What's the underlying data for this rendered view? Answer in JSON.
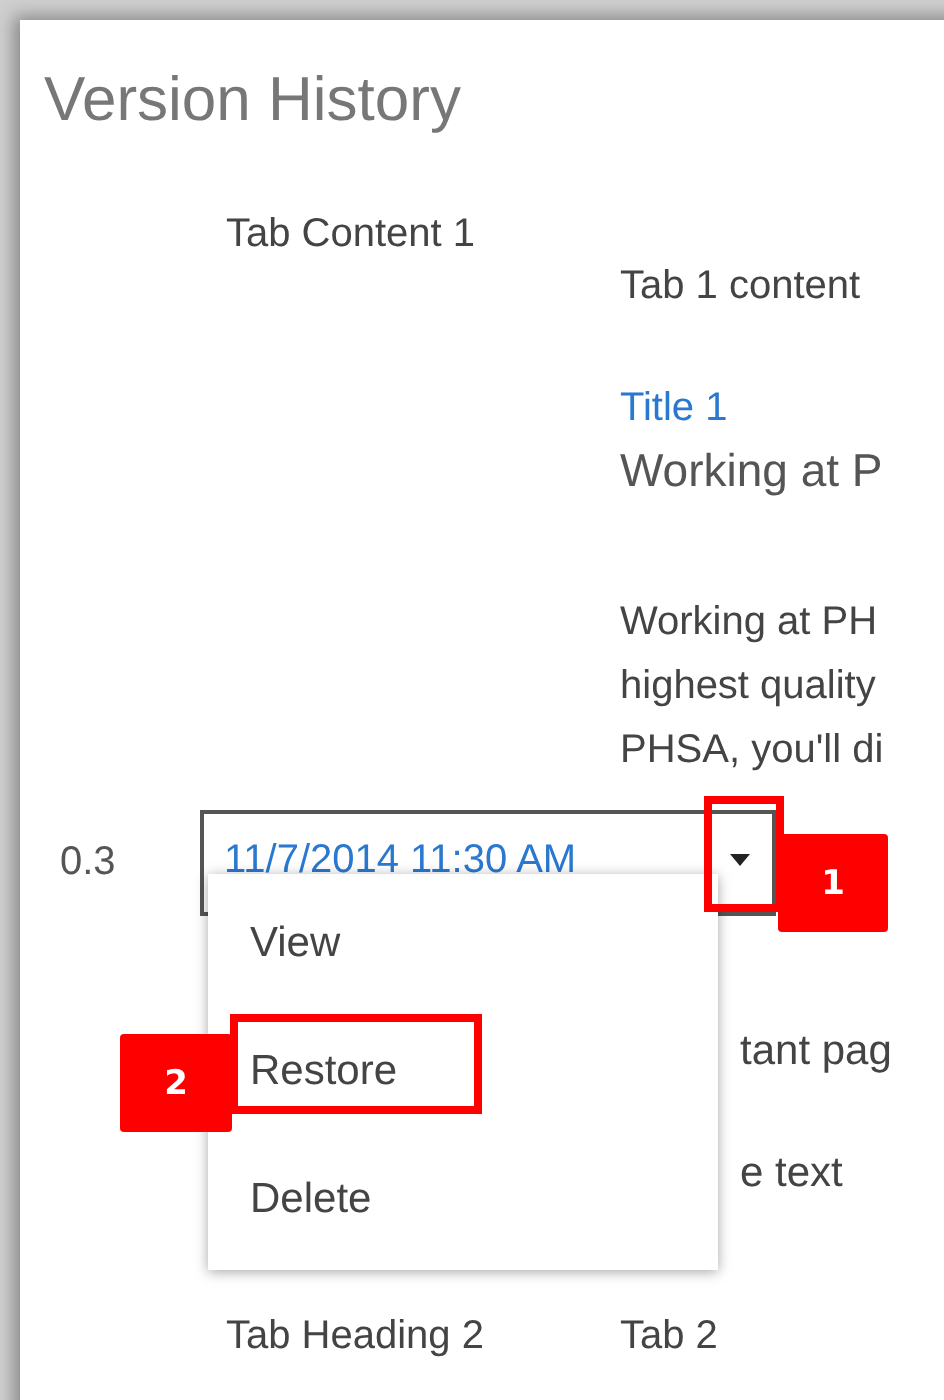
{
  "dialog": {
    "title": "Version History"
  },
  "tab_heading_1": "Tab Content 1",
  "tab_content": {
    "label": "Tab 1 content",
    "link_title": "Title 1",
    "subtitle": "Working at P",
    "paragraph_lines": [
      "Working at PH",
      "highest quality",
      "PHSA, you'll di"
    ]
  },
  "version": {
    "number": "0.3",
    "date": "11/7/2014 11:30 AM"
  },
  "menu": {
    "items": [
      "View",
      "Restore",
      "Delete"
    ]
  },
  "background_fragments": [
    "tant pag",
    "e text"
  ],
  "tab_row_2": {
    "heading": "Tab Heading 2",
    "content": "Tab 2"
  },
  "callouts": [
    {
      "number": "1"
    },
    {
      "number": "2"
    }
  ]
}
